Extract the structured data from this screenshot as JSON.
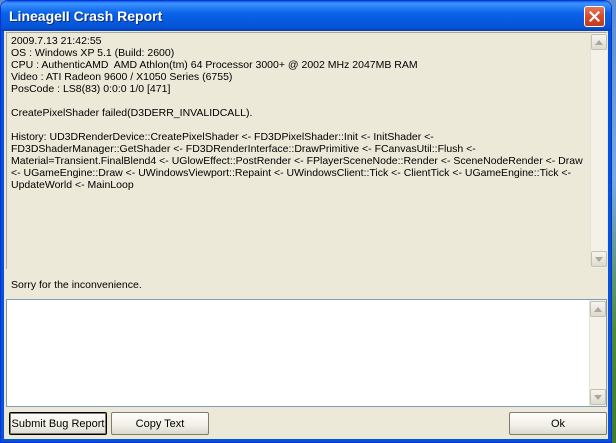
{
  "window": {
    "title": "LineageII Crash Report"
  },
  "report": {
    "lines": [
      "2009.7.13 21:42:55",
      "OS : Windows XP 5.1 (Build: 2600)",
      "CPU : AuthenticAMD  AMD Athlon(tm) 64 Processor 3000+ @ 2002 MHz 2047MB RAM",
      "Video : ATI Radeon 9600 / X1050 Series (6755)",
      "PosCode : LS8(83) 0:0:0 1/0 [471]",
      "",
      "CreatePixelShader failed(D3DERR_INVALIDCALL).",
      "",
      "History: UD3DRenderDevice::CreatePixelShader <- FD3DPixelShader::Init <- InitShader <- FD3DShaderManager::GetShader <- FD3DRenderInterface::DrawPrimitive <- FCanvasUtil::Flush <- Material=Transient.FinalBlend4 <- UGlowEffect::PostRender <- FPlayerSceneNode::Render <- SceneNodeRender <- Draw <- UGameEngine::Draw <- UWindowsViewport::Repaint <- UWindowsClient::Tick <- ClientTick <- UGameEngine::Tick <- UpdateWorld <- MainLoop"
    ]
  },
  "apology": "Sorry for the inconvenience.",
  "comment": {
    "value": ""
  },
  "buttons": {
    "submit": "Submit Bug Report",
    "copy": "Copy Text",
    "ok": "Ok"
  },
  "colors": {
    "titlebar": "#0553d6",
    "close": "#d64b2c",
    "dialog": "#ece9d8"
  }
}
